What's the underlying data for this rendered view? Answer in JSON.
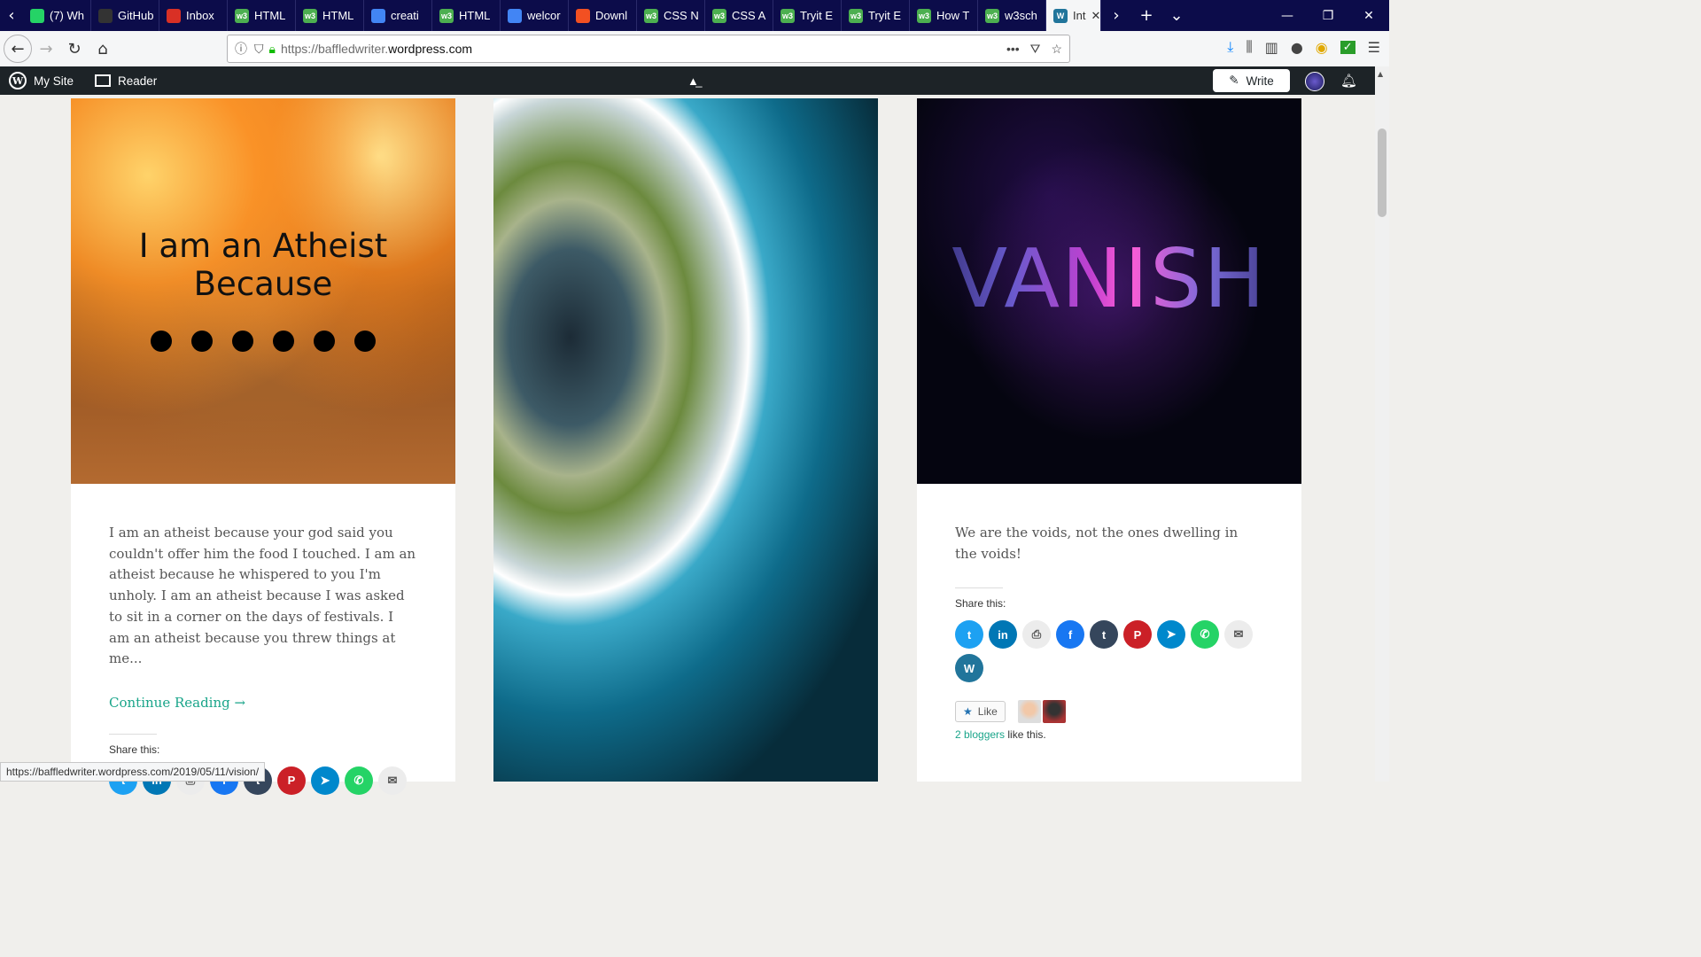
{
  "browser": {
    "tabs": [
      {
        "label": "(7) Wh",
        "icon": "whatsapp-icon",
        "color": "#25d366"
      },
      {
        "label": "GitHub",
        "icon": "github-icon",
        "color": "#333333"
      },
      {
        "label": "Inbox",
        "icon": "gmail-icon",
        "color": "#d93025"
      },
      {
        "label": "HTML",
        "icon": "w3schools-icon",
        "color": "#4caf50"
      },
      {
        "label": "HTML",
        "icon": "w3schools-icon",
        "color": "#4caf50"
      },
      {
        "label": "creati",
        "icon": "google-icon",
        "color": "#4285f4"
      },
      {
        "label": "HTML",
        "icon": "w3schools-icon",
        "color": "#4caf50"
      },
      {
        "label": "welcor",
        "icon": "google-icon",
        "color": "#4285f4"
      },
      {
        "label": "Downl",
        "icon": "microsoft-icon",
        "color": "#f25022"
      },
      {
        "label": "CSS N",
        "icon": "w3schools-icon",
        "color": "#4caf50"
      },
      {
        "label": "CSS A",
        "icon": "w3schools-icon",
        "color": "#4caf50"
      },
      {
        "label": "Tryit E",
        "icon": "w3schools-icon",
        "color": "#4caf50"
      },
      {
        "label": "Tryit E",
        "icon": "w3schools-icon",
        "color": "#4caf50"
      },
      {
        "label": "How T",
        "icon": "w3schools-icon",
        "color": "#4caf50"
      },
      {
        "label": "w3sch",
        "icon": "w3schools-icon",
        "color": "#4caf50"
      }
    ],
    "active_tab": {
      "label": "Int",
      "icon": "wordpress-icon"
    },
    "url_prefix": "https://baffledwriter.",
    "url_domain": "wordpress.com",
    "status_url": "https://baffledwriter.wordpress.com/2019/05/11/vision/"
  },
  "wpbar": {
    "my_site": "My Site",
    "reader": "Reader",
    "write": "Write"
  },
  "posts": [
    {
      "image_title": "I am an Atheist Because",
      "excerpt": "I am an atheist because your god said you couldn't offer him the food I touched. I am an atheist because he whispered to you I'm unholy. I am an atheist because I was asked to sit in a corner on the days of festivals. I am an atheist because you threw things at me...",
      "continue": "Continue Reading →",
      "share_label": "Share this:"
    },
    {
      "image_title": ""
    },
    {
      "image_title": "VANISH",
      "excerpt": "We are the voids, not the ones dwelling in the voids!",
      "share_label": "Share this:",
      "like": "Like",
      "likes_count": "2 bloggers",
      "likes_suffix": " like this."
    }
  ],
  "share_buttons": [
    {
      "name": "twitter",
      "glyph": "t",
      "color": "#1da1f2"
    },
    {
      "name": "linkedin",
      "glyph": "in",
      "color": "#0077b5"
    },
    {
      "name": "print",
      "glyph": "⎙",
      "color": "#ececec"
    },
    {
      "name": "facebook",
      "glyph": "f",
      "color": "#1877f2"
    },
    {
      "name": "tumblr",
      "glyph": "t",
      "color": "#35465c"
    },
    {
      "name": "pinterest",
      "glyph": "P",
      "color": "#cb2027"
    },
    {
      "name": "telegram",
      "glyph": "➤",
      "color": "#0088cc"
    },
    {
      "name": "whatsapp",
      "glyph": "✆",
      "color": "#25d366"
    },
    {
      "name": "email",
      "glyph": "✉",
      "color": "#ececec"
    },
    {
      "name": "wordpress",
      "glyph": "W",
      "color": "#21759b"
    }
  ]
}
